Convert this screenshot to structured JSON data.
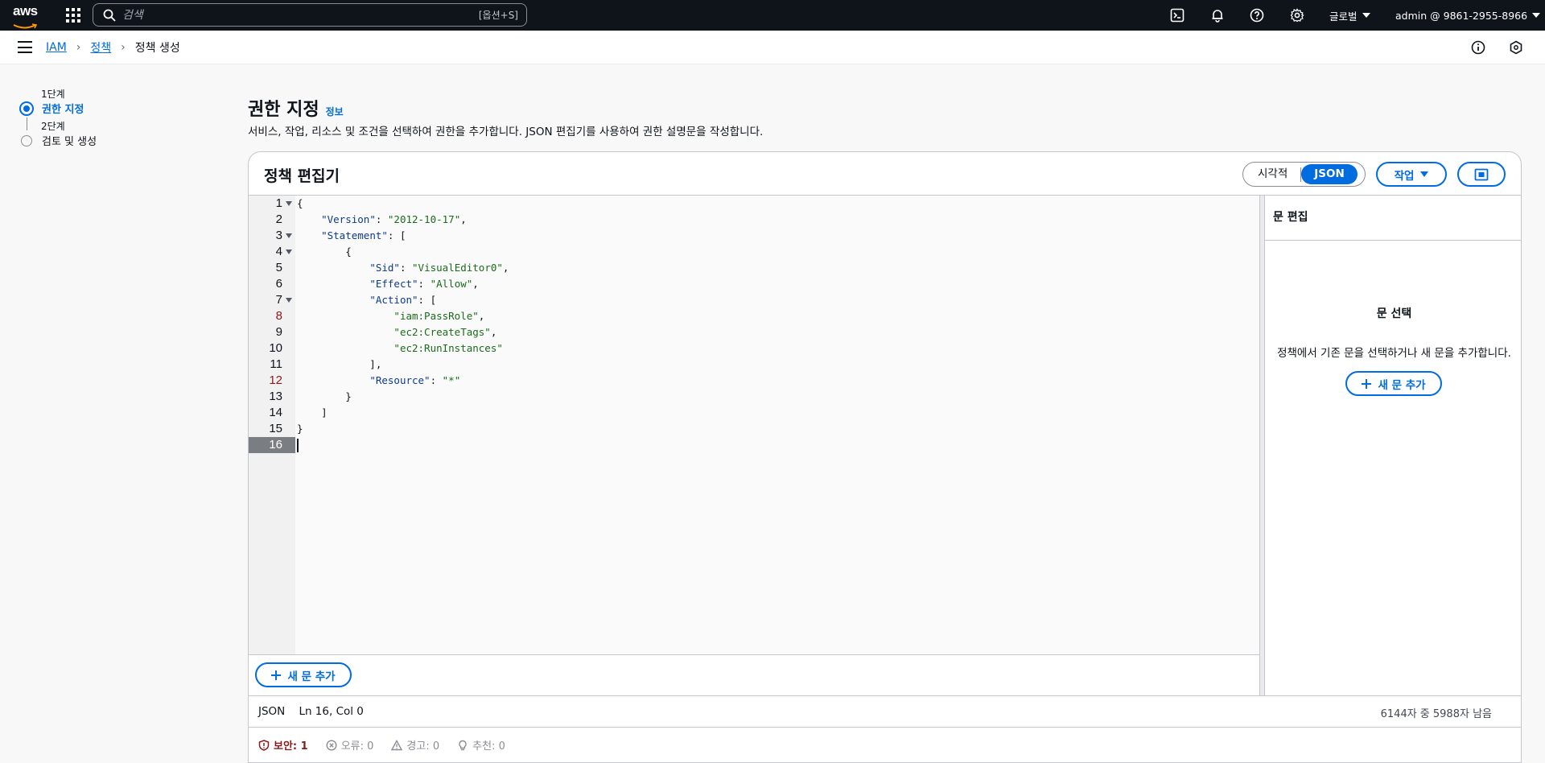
{
  "topnav": {
    "logo_text": "aws",
    "search_placeholder": "검색",
    "search_shortcut": "[옵션+S]",
    "region": "글로벌",
    "account": "admin @ 9861-2955-8966"
  },
  "breadcrumb": {
    "items": [
      "IAM",
      "정책"
    ],
    "current": "정책 생성"
  },
  "wizard": {
    "steps": [
      {
        "step": "1단계",
        "title": "권한 지정"
      },
      {
        "step": "2단계",
        "title": "검토 및 생성"
      }
    ]
  },
  "header": {
    "title": "권한 지정",
    "info": "정보",
    "description": "서비스, 작업, 리소스 및 조건을 선택하여 권한을 추가합니다. JSON 편집기를 사용하여 권한 설명문을 작성합니다."
  },
  "editor_panel": {
    "title": "정책 편집기",
    "mode_visual": "시각적",
    "mode_json": "JSON",
    "actions_label": "작업",
    "add_statement": "새 문 추가",
    "code_lines": [
      "{",
      "    \"Version\": \"2012-10-17\",",
      "    \"Statement\": [",
      "        {",
      "            \"Sid\": \"VisualEditor0\",",
      "            \"Effect\": \"Allow\",",
      "            \"Action\": [",
      "                \"iam:PassRole\",",
      "                \"ec2:CreateTags\",",
      "                \"ec2:RunInstances\"",
      "            ],",
      "            \"Resource\": \"*\"",
      "        }",
      "    ]",
      "}",
      ""
    ],
    "status_left": "JSON    Ln 16, Col 0",
    "status_right": "6144자 중 5988자 남음",
    "issues": {
      "security": "보안: 1",
      "errors": "오류: 0",
      "warnings": "경고: 0",
      "suggestions": "추천: 0"
    }
  },
  "side_panel": {
    "title": "문 편집",
    "select_title": "문 선택",
    "select_desc": "정책에서 기존 문을 선택하거나 새 문을 추가합니다.",
    "add_statement": "새 문 추가"
  }
}
